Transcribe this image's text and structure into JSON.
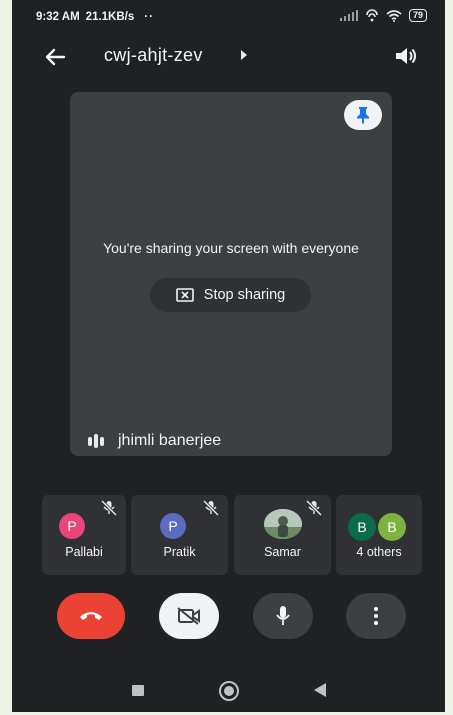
{
  "status_bar": {
    "time": "9:32 AM",
    "speed": "21.1KB/s",
    "dots": "··",
    "battery": "79"
  },
  "header": {
    "meeting_code": "cwj-ahjt-zev",
    "back_icon": "arrow-left-icon",
    "speaker_icon": "speaker-icon"
  },
  "stage": {
    "share_message": "You're sharing your screen with everyone",
    "stop_sharing_label": "Stop sharing",
    "presenter_name": "jhimli banerjee"
  },
  "participants": [
    {
      "name": "Pallabi",
      "initial": "P",
      "color": "#e8457b",
      "muted": true
    },
    {
      "name": "Pratik",
      "initial": "P",
      "color": "#5c6bc0",
      "muted": true
    },
    {
      "name": "Samar",
      "initial": "",
      "color": "#8aa28f",
      "muted": true
    },
    {
      "name": "4 others",
      "initials": [
        "B",
        "B"
      ],
      "colors": [
        "#0b6b4a",
        "#7cb342"
      ]
    }
  ],
  "controls": {
    "end_call_icon": "phone-hangup-icon",
    "camera_icon": "video-off-icon",
    "mic_icon": "microphone-icon",
    "more_icon": "more-vert-icon"
  },
  "colors": {
    "background": "#202124",
    "end_call": "#ea4335",
    "pin": "#1a73e8"
  }
}
